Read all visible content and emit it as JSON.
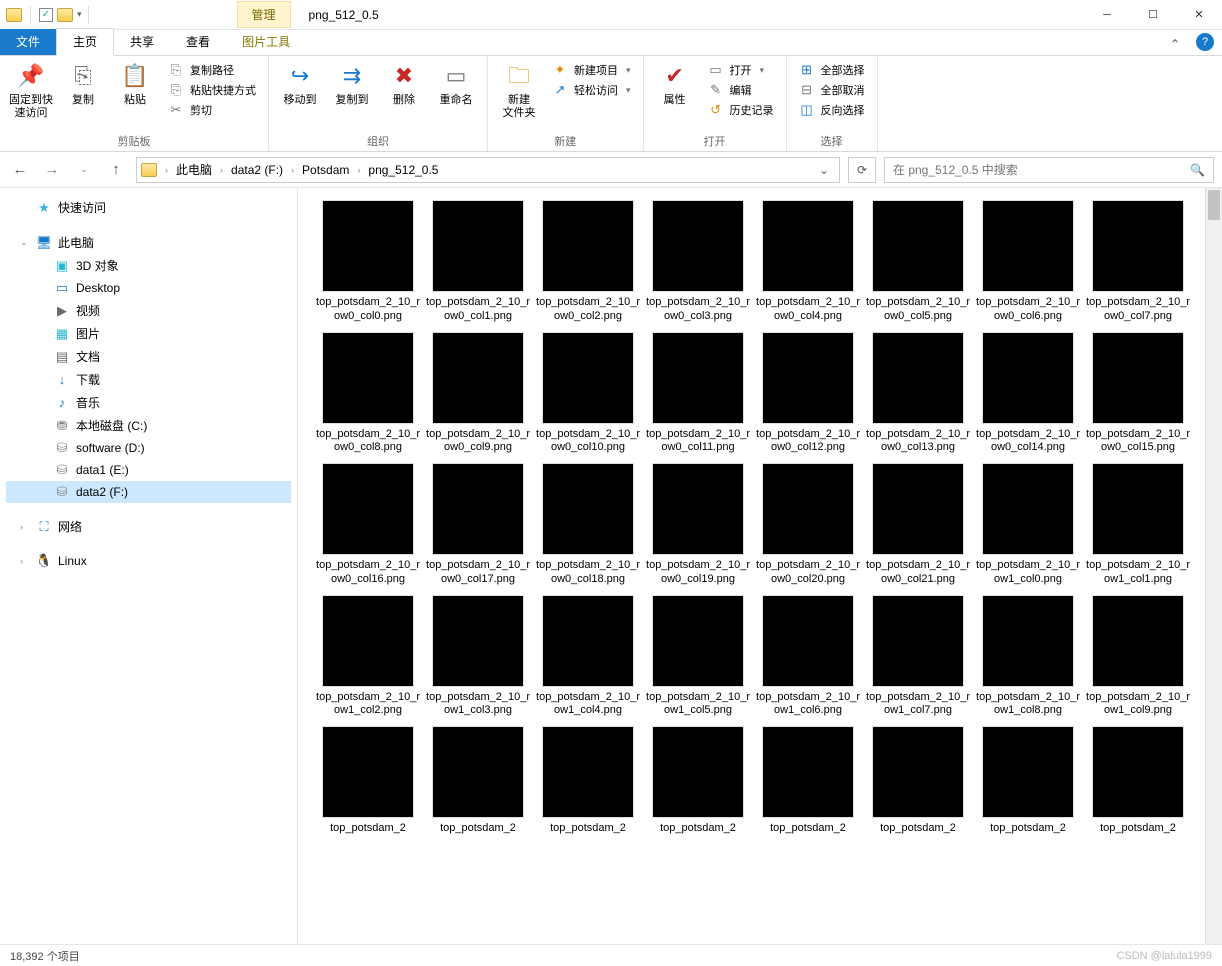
{
  "window": {
    "title": "png_512_0.5",
    "manage_tab": "管理",
    "tool_tab": "图片工具"
  },
  "tabs": {
    "file": "文件",
    "home": "主页",
    "share": "共享",
    "view": "查看"
  },
  "ribbon": {
    "clipboard": {
      "label": "剪贴板",
      "pin": "固定到快\n速访问",
      "copy": "复制",
      "paste": "粘贴",
      "copypath": "复制路径",
      "pasteshortcut": "粘贴快捷方式",
      "cut": "剪切"
    },
    "organize": {
      "label": "组织",
      "moveto": "移动到",
      "copyto": "复制到",
      "delete": "删除",
      "rename": "重命名"
    },
    "new": {
      "label": "新建",
      "newfolder": "新建\n文件夹",
      "newitem": "新建项目",
      "easyaccess": "轻松访问"
    },
    "open": {
      "label": "打开",
      "properties": "属性",
      "open": "打开",
      "edit": "编辑",
      "history": "历史记录"
    },
    "select": {
      "label": "选择",
      "selectall": "全部选择",
      "selectnone": "全部取消",
      "invert": "反向选择"
    }
  },
  "breadcrumbs": [
    "此电脑",
    "data2 (F:)",
    "Potsdam",
    "png_512_0.5"
  ],
  "search": {
    "placeholder": "在 png_512_0.5 中搜索"
  },
  "tree": [
    {
      "label": "快速访问",
      "icon": "★",
      "color": "#3bb1e8",
      "tw": "",
      "indent": 0
    },
    {
      "gap": true
    },
    {
      "label": "此电脑",
      "icon": "🖥",
      "color": "#1979ca",
      "tw": "⌄",
      "indent": 0
    },
    {
      "label": "3D 对象",
      "icon": "▣",
      "color": "#27b7d6",
      "indent": 1
    },
    {
      "label": "Desktop",
      "icon": "▭",
      "color": "#1979ca",
      "indent": 1
    },
    {
      "label": "视频",
      "icon": "▶",
      "color": "#6b6b6b",
      "indent": 1
    },
    {
      "label": "图片",
      "icon": "▦",
      "color": "#27b7d6",
      "indent": 1
    },
    {
      "label": "文档",
      "icon": "▤",
      "color": "#6b6b6b",
      "indent": 1
    },
    {
      "label": "下载",
      "icon": "↓",
      "color": "#1979ca",
      "indent": 1
    },
    {
      "label": "音乐",
      "icon": "♪",
      "color": "#1979ca",
      "indent": 1
    },
    {
      "label": "本地磁盘 (C:)",
      "icon": "⛃",
      "color": "#888",
      "indent": 1
    },
    {
      "label": "software (D:)",
      "icon": "⛁",
      "color": "#888",
      "indent": 1
    },
    {
      "label": "data1 (E:)",
      "icon": "⛁",
      "color": "#888",
      "indent": 1
    },
    {
      "label": "data2 (F:)",
      "icon": "⛁",
      "color": "#888",
      "indent": 1,
      "selected": true
    },
    {
      "gap": true
    },
    {
      "label": "网络",
      "icon": "⛶",
      "color": "#1979ca",
      "tw": "›",
      "indent": 0
    },
    {
      "gap": true
    },
    {
      "label": "Linux",
      "icon": "🐧",
      "color": "#333",
      "tw": "›",
      "indent": 0
    }
  ],
  "files": [
    "top_potsdam_2_10_row0_col0.png",
    "top_potsdam_2_10_row0_col1.png",
    "top_potsdam_2_10_row0_col2.png",
    "top_potsdam_2_10_row0_col3.png",
    "top_potsdam_2_10_row0_col4.png",
    "top_potsdam_2_10_row0_col5.png",
    "top_potsdam_2_10_row0_col6.png",
    "top_potsdam_2_10_row0_col7.png",
    "top_potsdam_2_10_row0_col8.png",
    "top_potsdam_2_10_row0_col9.png",
    "top_potsdam_2_10_row0_col10.png",
    "top_potsdam_2_10_row0_col11.png",
    "top_potsdam_2_10_row0_col12.png",
    "top_potsdam_2_10_row0_col13.png",
    "top_potsdam_2_10_row0_col14.png",
    "top_potsdam_2_10_row0_col15.png",
    "top_potsdam_2_10_row0_col16.png",
    "top_potsdam_2_10_row0_col17.png",
    "top_potsdam_2_10_row0_col18.png",
    "top_potsdam_2_10_row0_col19.png",
    "top_potsdam_2_10_row0_col20.png",
    "top_potsdam_2_10_row0_col21.png",
    "top_potsdam_2_10_row1_col0.png",
    "top_potsdam_2_10_row1_col1.png",
    "top_potsdam_2_10_row1_col2.png",
    "top_potsdam_2_10_row1_col3.png",
    "top_potsdam_2_10_row1_col4.png",
    "top_potsdam_2_10_row1_col5.png",
    "top_potsdam_2_10_row1_col6.png",
    "top_potsdam_2_10_row1_col7.png",
    "top_potsdam_2_10_row1_col8.png",
    "top_potsdam_2_10_row1_col9.png",
    "top_potsdam_2",
    "top_potsdam_2",
    "top_potsdam_2",
    "top_potsdam_2",
    "top_potsdam_2",
    "top_potsdam_2",
    "top_potsdam_2",
    "top_potsdam_2"
  ],
  "status": {
    "count": "18,392 个项目",
    "watermark": "CSDN @lalula1999"
  }
}
